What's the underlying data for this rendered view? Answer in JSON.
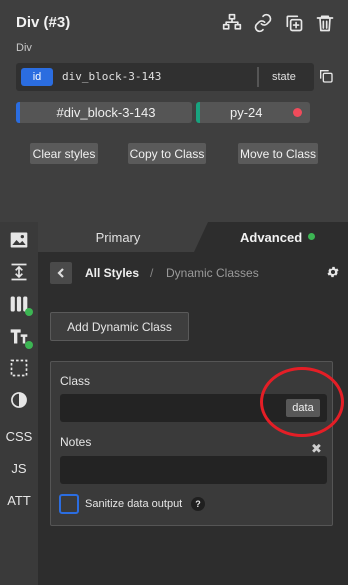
{
  "header": {
    "title": "Div (#3)",
    "subtitle": "Div",
    "icons": [
      "structure-icon",
      "link-icon",
      "duplicate-icon",
      "trash-icon"
    ]
  },
  "id_row": {
    "badge": "id",
    "value": "div_block-3-143",
    "state_label": "state"
  },
  "selectors": {
    "id_chip": "#div_block-3-143",
    "class_chip": "py-24",
    "id_color": "#2b6de0",
    "class_color": "#18a37f",
    "class_dot_color": "#ef4b5b"
  },
  "actions": {
    "clear": "Clear styles",
    "copy": "Copy to Class",
    "move": "Move to Class"
  },
  "sidebar": {
    "items": [
      "image-icon",
      "spacing-icon",
      "columns-icon",
      "typography-icon",
      "borders-icon",
      "effects-icon",
      "CSS",
      "JS",
      "ATT"
    ]
  },
  "tabs": {
    "primary": "Primary",
    "advanced": "Advanced",
    "active": "Advanced"
  },
  "breadcrumb": {
    "root": "All Styles",
    "separator": "/",
    "current": "Dynamic Classes"
  },
  "dynamic": {
    "add_button": "Add Dynamic Class",
    "class_label": "Class",
    "class_value": "",
    "data_button": "data",
    "notes_label": "Notes",
    "notes_value": "",
    "sanitize_label": "Sanitize data output",
    "help": "?"
  },
  "annotation_color": "#e41e26"
}
